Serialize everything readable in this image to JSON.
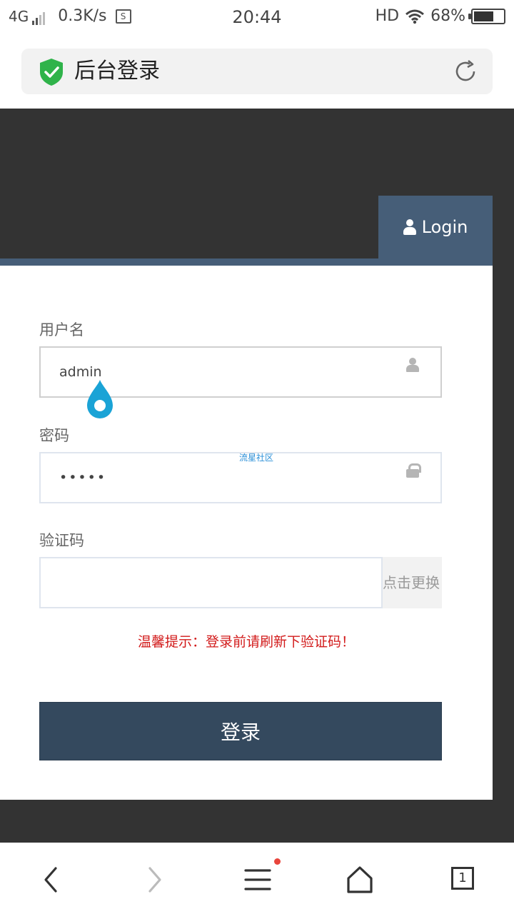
{
  "status_bar": {
    "network": "4G",
    "speed": "0.3K/s",
    "time": "20:44",
    "hd": "HD",
    "battery": "68%",
    "battery_level": 0.68
  },
  "address_bar": {
    "title": "后台登录",
    "secure_icon": "shield-check-icon",
    "reload_icon": "refresh-icon"
  },
  "login_tab": {
    "label": "Login",
    "icon": "user-icon"
  },
  "form": {
    "username": {
      "label": "用户名",
      "value": "admin",
      "icon": "user-icon"
    },
    "password": {
      "label": "密码",
      "value": "•••••",
      "icon": "lock-icon"
    },
    "captcha": {
      "label": "验证码",
      "value": "",
      "button": "点击更换"
    },
    "watermark": "流星社区",
    "tip": "温馨提示：登录前请刷新下验证码！",
    "submit": "登录"
  },
  "bottom_nav": {
    "back": "back-icon",
    "forward": "forward-icon",
    "menu": "menu-icon",
    "home": "home-icon",
    "tabs_count": "1"
  },
  "colors": {
    "header_dark": "#333333",
    "accent": "#465e78",
    "button": "#34495e",
    "tip": "#d21a1a",
    "shield": "#2fb34a"
  }
}
